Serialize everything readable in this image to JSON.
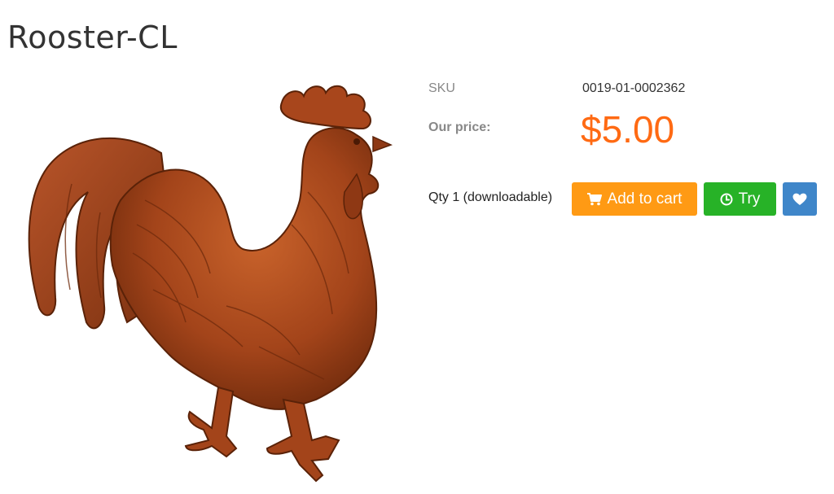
{
  "product": {
    "title": "Rooster-CL",
    "image_alt": "Rooster relief carving"
  },
  "details": {
    "sku_label": "SKU",
    "sku_value": "0019-01-0002362",
    "price_label": "Our price:",
    "price_value": "$5.00",
    "qty_text": "Qty 1 (downloadable)"
  },
  "actions": {
    "add_to_cart_label": "Add to cart",
    "try_label": "Try",
    "add_to_cart_icon": "cart-icon",
    "try_icon": "clock-icon",
    "wishlist_icon": "heart-icon"
  },
  "colors": {
    "price": "#ff6a13",
    "add_to_cart": "#ff9a14",
    "try": "#27b227",
    "wishlist": "#3f86c9",
    "rooster": "#a8461c"
  }
}
